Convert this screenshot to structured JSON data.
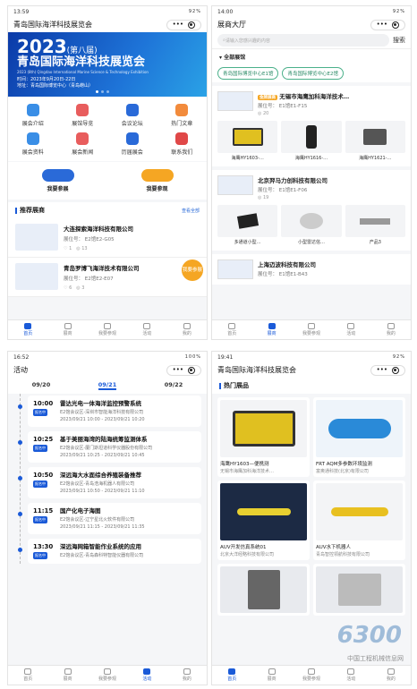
{
  "p1": {
    "time": "13:59",
    "status": "92%",
    "title": "青岛国际海洋科技展览会",
    "banner": {
      "year": "2023",
      "nth": "(第八届)",
      "title": "青岛国际海洋科技展览会",
      "en": "2023 (8th) Qingdao International Marine Science & Technology Exhibition",
      "date": "时间：2023年9月20日-22日",
      "venue": "地址：青岛国际博览中心（青岛崂山）"
    },
    "menu": [
      "展会介绍",
      "展馆导览",
      "会议论坛",
      "热门文章",
      "展会资料",
      "展会新闻",
      "历届展会",
      "联系我们"
    ],
    "reg": [
      "我要参展",
      "我要参观"
    ],
    "sec": "推荐展商",
    "more": "查看全部",
    "cards": [
      {
        "name": "大连探索海洋科技有限公司",
        "booth": "展位号： E2馆E2-G05",
        "like": "1",
        "view": "13"
      },
      {
        "name": "青岛罗博飞海洋技术有限公司",
        "booth": "展位号： E2馆E2-E07",
        "like": "6",
        "view": "3"
      }
    ],
    "float": "我要参展"
  },
  "nav": [
    "首页",
    "展商",
    "我要参观",
    "活动",
    "我的"
  ],
  "p2": {
    "time": "14:00",
    "status": "92%",
    "title": "展商大厅",
    "search_ph": "请输入您感兴趣的内容",
    "search_btn": "搜索",
    "filter": "全部展馆",
    "halls": [
      "青岛国际博览中心E1馆",
      "青岛国际博览中心E2馆"
    ],
    "exh": [
      {
        "tag": "金牌展商",
        "name": "无锡市海鹰加科海洋技术…",
        "booth": "展位号： E1馆E1-F15",
        "views": "20",
        "products": [
          "海鹰HY1603-…",
          "海鹰HY1616-…",
          "海鹰HY1621-…"
        ]
      },
      {
        "name": "北京羿马力创科技有限公司",
        "booth": "展位号： E1馆E1-F06",
        "views": "19",
        "products": [
          "多通道小型…",
          "小型雷达信…",
          "产品3"
        ]
      },
      {
        "name": "上海迈波科技有限公司",
        "booth": "展位号： E1馆E1-B43"
      }
    ]
  },
  "p3": {
    "time": "16:52",
    "status": "100%",
    "title": "活动",
    "dates": [
      "09/20",
      "09/21",
      "09/22"
    ],
    "events": [
      {
        "t": "10:00",
        "title": "雷达光电一体海洋监控预警系统",
        "addr": "E2馆会议区-深圳市智能海洋科技有限公司",
        "time": "2023/09/21 10:00 - 2023/09/21 10:20"
      },
      {
        "t": "10:25",
        "title": "基于美丽海湾的陆海统筹监测体系",
        "addr": "E2馆会议区-厦门斯坦道科学仪器股份有限公司",
        "time": "2023/09/21 10:25 - 2023/09/21 10:45"
      },
      {
        "t": "10:50",
        "title": "深远海大水面综合养殖装备推荐",
        "addr": "E2馆会议区-青岛浩海机器人有限公司",
        "time": "2023/09/21 10:50 - 2023/09/21 11:10"
      },
      {
        "t": "11:15",
        "title": "国产化电子海图",
        "addr": "E2馆会议区-辽宁星北火软件有限公司",
        "time": "2023/09/21 11:15 - 2023/09/21 11:35"
      },
      {
        "t": "13:30",
        "title": "深远海网箱智能作业系统的应用",
        "addr": "E2馆会议区-青岛森科特智能仪器有限公司"
      }
    ],
    "badge": "报名中"
  },
  "p4": {
    "time": "19:41",
    "status": "92%",
    "title": "青岛国际海洋科技展览会",
    "sec": "热门展品",
    "prods": [
      {
        "name": "海鹰HY1603—便携测",
        "co": "无锡市海鹰加科海洋技术…"
      },
      {
        "name": "FRT AQM多参数环境监测",
        "co": "富奥通科技(北京)有限公司"
      },
      {
        "name": "AUV开发仿真系统01",
        "co": "北京大洋经略科技有限公司"
      },
      {
        "name": "AUV水下机器人",
        "co": "青岛智控领航科技有限公司"
      },
      {
        "name": "",
        "co": ""
      },
      {
        "name": "",
        "co": ""
      }
    ],
    "wm": "6300",
    "wm2": "中国工程机械信息网"
  }
}
